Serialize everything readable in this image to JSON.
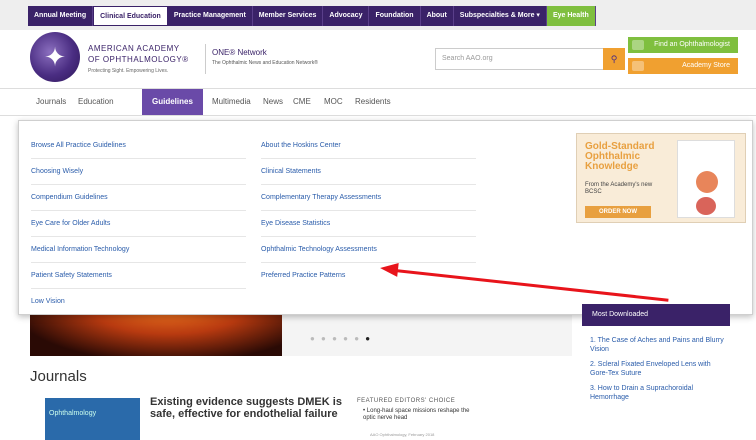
{
  "topbar": {
    "items": [
      {
        "label": "Annual Meeting",
        "state": "normal"
      },
      {
        "label": "Clinical Education",
        "state": "active"
      },
      {
        "label": "Practice Management",
        "state": "normal"
      },
      {
        "label": "Member Services",
        "state": "normal"
      },
      {
        "label": "Advocacy",
        "state": "normal"
      },
      {
        "label": "Foundation",
        "state": "normal"
      },
      {
        "label": "About",
        "state": "normal"
      },
      {
        "label": "Subspecialties & More ▾",
        "state": "normal"
      },
      {
        "label": "Eye Health",
        "state": "green"
      }
    ]
  },
  "header": {
    "org_line1": "AMERICAN ACADEMY",
    "org_line2": "OF OPHTHALMOLOGY®",
    "org_sub": "Protecting Sight. Empowering Lives.",
    "network_title": "ONE® Network",
    "network_sub": "The Ophthalmic News and Education Network®",
    "search_placeholder": "Search AAO.org",
    "find_btn": "Find an Ophthalmologist",
    "store_btn": "Academy Store",
    "icons": {
      "logo": "aao-logo-icon",
      "search": "search-icon"
    }
  },
  "mainnav": {
    "items": [
      {
        "label": "Journals"
      },
      {
        "label": "Education"
      },
      {
        "label": "Guidelines",
        "active": true
      },
      {
        "label": "Multimedia"
      },
      {
        "label": "News"
      },
      {
        "label": "CME"
      },
      {
        "label": "MOC"
      },
      {
        "label": "Residents"
      }
    ]
  },
  "dropdown": {
    "col1": [
      "Browse All Practice Guidelines",
      "Choosing Wisely",
      "Compendium Guidelines",
      "Eye Care for Older Adults",
      "Medical Information Technology",
      "Patient Safety Statements",
      "Low Vision"
    ],
    "col2": [
      "About the Hoskins Center",
      "Clinical Statements",
      "Complementary Therapy Assessments",
      "Eye Disease Statistics",
      "Ophthalmic Technology Assessments",
      "Preferred Practice Patterns"
    ],
    "promo": {
      "title": "Gold-Standard Ophthalmic Knowledge",
      "subtitle": "From the Academy's new BCSC",
      "button": "ORDER NOW"
    }
  },
  "hero": {
    "carousel_dots": "● ● ● ● ●",
    "active_dot": "●"
  },
  "sidebar": {
    "box_title": "Most Downloaded",
    "items": [
      "1. The Case of Aches and Pains and Blurry Vision",
      "2. Scleral Fixated Enveloped Lens with Gore-Tex Suture",
      "3. How to Drain a Suprachoroidal Hemorrhage"
    ]
  },
  "journals": {
    "heading": "Journals",
    "cover_label": "Ophthalmology",
    "headline": "Existing evidence suggests DMEK is safe, effective for endothelial failure",
    "featured_label": "FEATURED EDITORS' CHOICE",
    "featured_item": "• Long-haul space missions reshape the optic nerve head",
    "featured_meta": "AAO Ophthalmology, February 2018"
  },
  "colors": {
    "brand_purple": "#3a2268",
    "nav_active": "#6a4aa8",
    "link_blue": "#2a5caa",
    "accent_orange": "#f0a030",
    "accent_green": "#7fbf3f",
    "annotation_red": "#e8141b"
  }
}
